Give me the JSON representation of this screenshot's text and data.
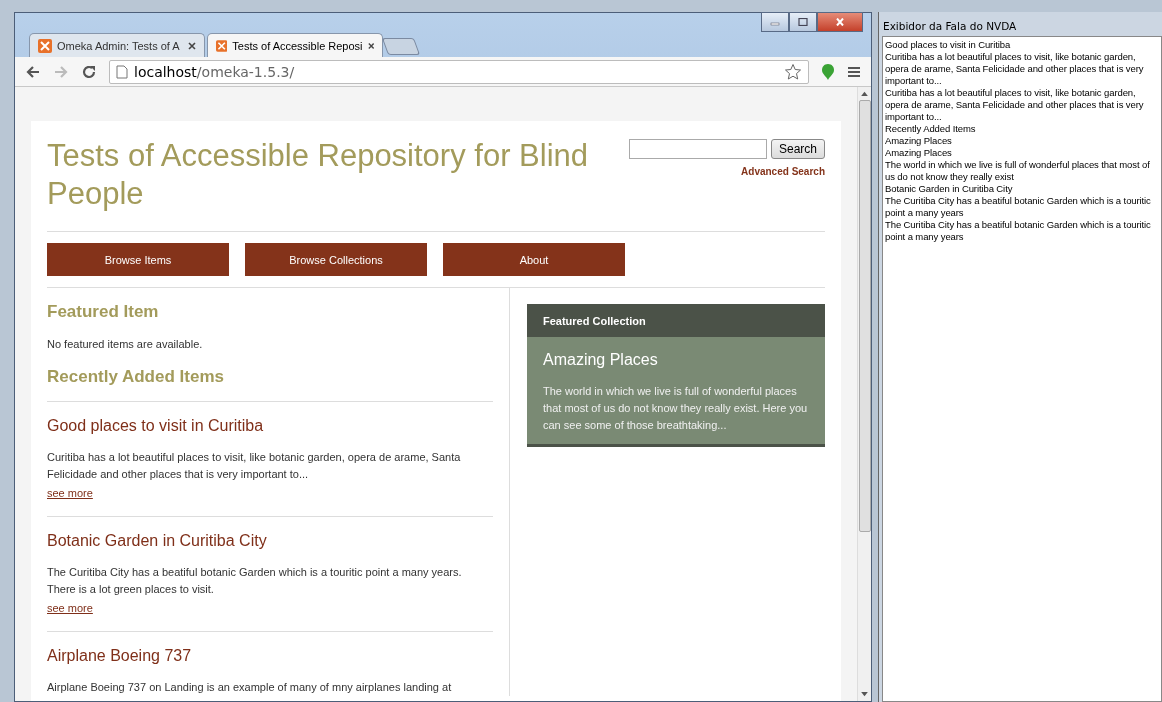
{
  "browser": {
    "tabs": [
      {
        "label": "Omeka Admin: Tests of A",
        "selected": false
      },
      {
        "label": "Tests of Accessible Reposi",
        "selected": true
      }
    ],
    "address": {
      "host": "localhost",
      "path": "/omeka-1.5.3/"
    }
  },
  "page": {
    "site_title": "Tests of Accessible Repository for Blind People",
    "search": {
      "button": "Search",
      "advanced": "Advanced Search"
    },
    "nav": [
      "Browse Items",
      "Browse Collections",
      "About"
    ],
    "featured_item": {
      "heading": "Featured Item",
      "message": "No featured items are available."
    },
    "recent": {
      "heading": "Recently Added Items",
      "items": [
        {
          "title": "Good places to visit in Curitiba",
          "description": "Curitiba has a lot beautiful places to visit, like botanic garden, opera de arame, Santa Felicidade and other places that is very important to...",
          "link": "see more"
        },
        {
          "title": "Botanic Garden in Curitiba City",
          "description": "The Curitiba City has a beatiful botanic Garden which is a touritic point a many years. There is a lot green places to visit.",
          "link": "see more"
        },
        {
          "title": "Airplane Boeing 737",
          "description": "Airplane Boeing 737 on Landing is an example of many of mny airplanes landing at"
        }
      ]
    },
    "featured_collection": {
      "heading": "Featured Collection",
      "title": "Amazing Places",
      "description": "The world in which we live is full of wonderful places that most of us do not know they really exist. Here you can see some of those breathtaking..."
    }
  },
  "speech_viewer": {
    "title": "Exibidor da Fala do NVDA",
    "lines": [
      "Good places to visit in Curitiba",
      "Curitiba has a lot beautiful places to visit, like botanic garden, opera de arame, Santa Felicidade and other places that is very important to...",
      "Curitiba has a lot beautiful places to visit, like botanic garden, opera de arame, Santa Felicidade and other places that is very important to...",
      "Recently Added Items",
      "Amazing Places",
      "Amazing Places",
      "The world in which we live is full of wonderful places that most of us do not know they really exist",
      "Botanic Garden in Curitiba City",
      "The Curitiba City has a beatiful botanic Garden which is a touritic point a many years",
      "The Curitiba City has a beatiful botanic Garden which is a touritic point a many years"
    ]
  }
}
